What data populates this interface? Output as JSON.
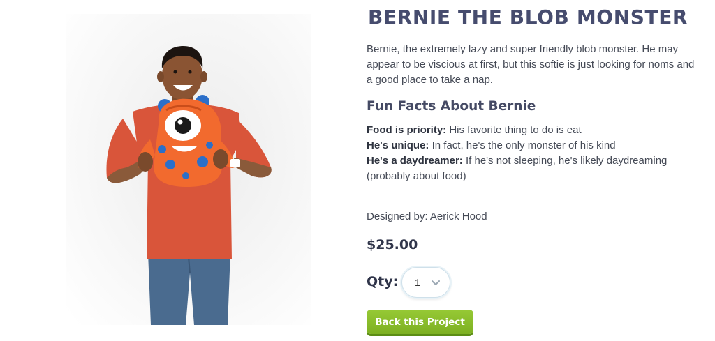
{
  "product": {
    "title": "BERNIE THE BLOB MONSTER",
    "description": "Bernie, the extremely lazy and super friendly blob monster. He may appear to be viscious at first, but this softie is just looking for noms and a good place to take a nap.",
    "facts_heading": "Fun Facts About Bernie",
    "facts": [
      {
        "name": "Food is priority:",
        "text": "His favorite thing to do is eat"
      },
      {
        "name": "He's unique:",
        "text": "In fact, he's the only monster of his kind"
      },
      {
        "name": "He's a daydreamer:",
        "text": "If he's not sleeping, he's likely daydreaming (probably about food)"
      }
    ],
    "designed_by": "Designed by: Aerick Hood",
    "price": "$25.00",
    "qty_label": "Qty:",
    "qty_value": "1",
    "back_button_label": "Back this Project"
  },
  "colors": {
    "title": "#464c6e",
    "button_green": "#8cbf2c",
    "plush_orange": "#f26a2e",
    "plush_spots": "#2b6fc9",
    "shirt": "#d9553a",
    "jeans": "#4a6b8f"
  },
  "icons": {
    "qty_dropdown": "chevron-down-icon"
  }
}
